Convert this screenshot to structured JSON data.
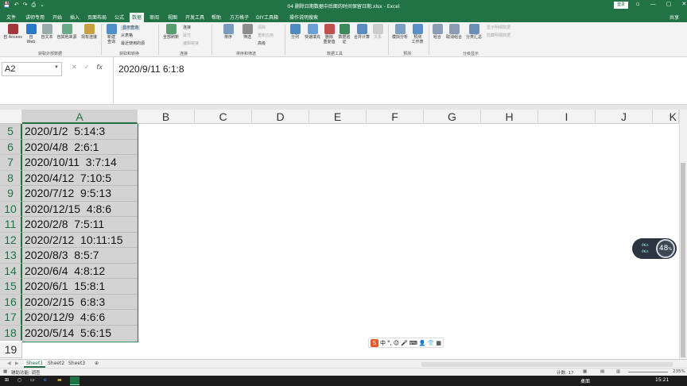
{
  "window": {
    "title": "04 删除日期数据中后面的时间保留日期.xlsx - Excel",
    "login": "登录",
    "controls": [
      "▫",
      "—",
      "▢",
      "✕"
    ]
  },
  "qat": [
    "💾",
    "↶",
    "↷",
    "⎙",
    "⌄"
  ],
  "tabs": [
    "文件",
    "讲师专用",
    "开始",
    "插入",
    "页面布局",
    "公式",
    "数据",
    "审阅",
    "视图",
    "帮助",
    "开发工具",
    "方方格子",
    "DIY工具箱",
    "操作说明搜索"
  ],
  "share": "共享",
  "ribbon": {
    "buttons": [
      "自 Access",
      "自\nWeb",
      "自文本",
      "自其他来源",
      "现有连接",
      "新建\n查询",
      "全部刷新",
      "排序",
      "筛选",
      "分列",
      "快速填充",
      "删除\n重复值",
      "数据验\n证",
      "合并计算",
      "关系",
      "模拟分析",
      "预测\n工作表",
      "组合",
      "取消组合",
      "分类汇总"
    ],
    "small": [
      "显示查询",
      "从表格",
      "最近使用的源",
      "连接",
      "属性",
      "编辑链接",
      "清除",
      "重新应用",
      "高级",
      "显示明细数据",
      "隐藏明细数据"
    ],
    "groups": [
      "获取外部数据",
      "获取和转换",
      "连接",
      "排序和筛选",
      "数据工具",
      "预测",
      "分级显示"
    ]
  },
  "namebox": "A2",
  "formula_icons": [
    "✕",
    "✓",
    "fx"
  ],
  "formula": "2020/9/11  6:1:8",
  "columns": [
    "A",
    "B",
    "C",
    "D",
    "E",
    "F",
    "G",
    "H",
    "I",
    "J",
    "K"
  ],
  "rows": [
    {
      "n": "5",
      "a": "2020/1/2  5:14:3"
    },
    {
      "n": "6",
      "a": "2020/4/8  2:6:1"
    },
    {
      "n": "7",
      "a": "2020/10/11  3:7:14"
    },
    {
      "n": "8",
      "a": "2020/4/12  7:10:5"
    },
    {
      "n": "9",
      "a": "2020/7/12  9:5:13"
    },
    {
      "n": "10",
      "a": "2020/12/15  4:8:6"
    },
    {
      "n": "11",
      "a": "2020/2/8  7:5:11"
    },
    {
      "n": "12",
      "a": "2020/2/12  10:11:15"
    },
    {
      "n": "13",
      "a": "2020/8/3  8:5:7"
    },
    {
      "n": "14",
      "a": "2020/6/4  4:8:12"
    },
    {
      "n": "15",
      "a": "2020/6/1  15:8:1"
    },
    {
      "n": "16",
      "a": "2020/2/15  6:8:3"
    },
    {
      "n": "17",
      "a": "2020/12/9  4:6:6"
    },
    {
      "n": "18",
      "a": "2020/5/14  5:6:15"
    },
    {
      "n": "19",
      "a": ""
    }
  ],
  "sheets": [
    "Sheet1",
    "Sheet2",
    "Sheet3"
  ],
  "add_sheet": "⊕",
  "status": {
    "left": "辅助功能: 调查",
    "count": "计数: 17",
    "zoom": "235%"
  },
  "ime": {
    "logo": "S",
    "items": [
      "中",
      "°,",
      "☺",
      "🎤",
      "⌨",
      "👤",
      "👕",
      "▦"
    ]
  },
  "widget": {
    "value": "48",
    "unit": "%",
    "l1": "0K/s",
    "l2": "0K/s"
  },
  "taskbar": {
    "right": "桌面",
    "time": "15:21"
  },
  "colors": {
    "excel_green": "#217346",
    "selection_gray": "#d3d3d3"
  }
}
